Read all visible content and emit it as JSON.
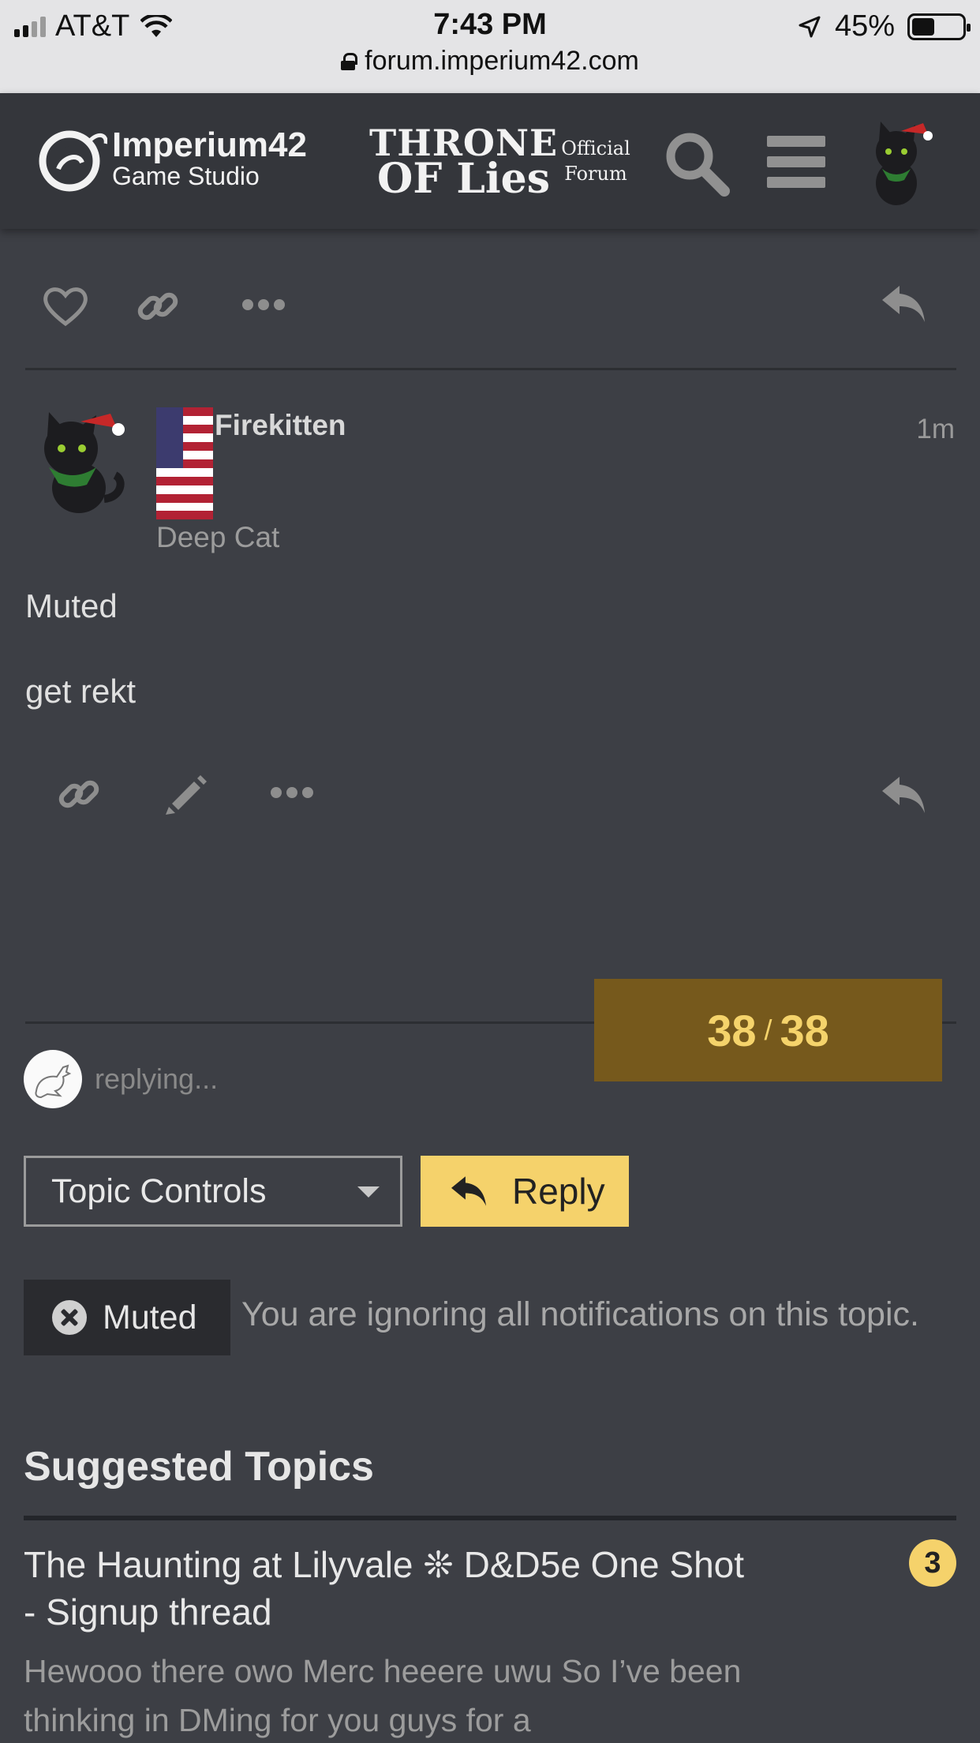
{
  "status_bar": {
    "carrier": "AT&T",
    "time": "7:43 PM",
    "battery": "45%",
    "url": "forum.imperium42.com"
  },
  "header": {
    "logo_name": "Imperium42",
    "logo_sub": "Game Studio",
    "game_line1": "THRONE",
    "game_line2": "OF Lies",
    "official_line1": "Official",
    "official_line2": "Forum"
  },
  "post": {
    "username": "Firekitten",
    "time": "1m",
    "user_title": "Deep Cat",
    "body_line1": "Muted",
    "body_line2": "get rekt"
  },
  "progress": {
    "current": "38",
    "total": "38"
  },
  "replying": {
    "text": "replying..."
  },
  "footer_buttons": {
    "topic_controls": "Topic Controls",
    "reply": "Reply"
  },
  "notification": {
    "label": "Muted",
    "description": "You are ignoring all notifications on this topic."
  },
  "suggested": {
    "heading": "Suggested Topics",
    "topics": [
      {
        "title": "The Haunting at Lilyvale ❊ D&D5e One Shot - Signup thread",
        "badge": "3",
        "excerpt": "Hewooo there owo Merc heeere uwu So I’ve been thinking in DMing for you guys for a"
      }
    ]
  },
  "colors": {
    "background": "#3d3f45",
    "header": "#34363b",
    "accent_yellow": "#f5d26b",
    "progress_bg": "#76591c"
  }
}
